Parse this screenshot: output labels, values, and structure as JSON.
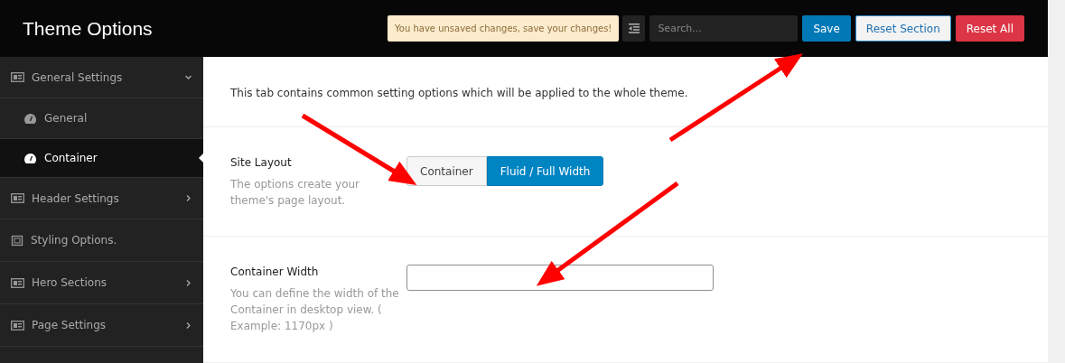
{
  "header": {
    "title": "Theme Options",
    "notice": "You have unsaved changes, save your changes!",
    "search": {
      "placeholder": "Search..."
    },
    "buttons": [
      {
        "label": "Save",
        "kind": "primary"
      },
      {
        "label": "Reset Section",
        "kind": "secondary"
      },
      {
        "label": "Reset All",
        "kind": "danger"
      }
    ]
  },
  "sidebar": {
    "items": [
      {
        "label": "General Settings",
        "kind": "group",
        "expanded": true,
        "selected": false,
        "children": [
          {
            "label": "General",
            "kind": "child",
            "selected": false
          },
          {
            "label": "Container",
            "kind": "child",
            "selected": true
          }
        ]
      },
      {
        "label": "Header Settings",
        "kind": "group",
        "expanded": false,
        "selected": false
      },
      {
        "label": "Styling Options.",
        "kind": "page",
        "selected": false
      },
      {
        "label": "Hero Sections",
        "kind": "group",
        "expanded": false,
        "selected": false
      },
      {
        "label": "Page Settings",
        "kind": "group",
        "expanded": false,
        "selected": false
      }
    ]
  },
  "content": {
    "intro": "This tab contains common setting options which will be applied to the whole theme.",
    "settings": [
      {
        "title": "Site Layout",
        "description": "The options create your theme's page layout.",
        "kind": "button_set",
        "options": [
          {
            "label": "Container",
            "selected": false
          },
          {
            "label": "Fluid / Full Width",
            "selected": true
          }
        ]
      },
      {
        "title": "Container Width",
        "description": "You can define the width of the Container in desktop view. ( Example: 1170px )",
        "kind": "text"
      }
    ]
  }
}
